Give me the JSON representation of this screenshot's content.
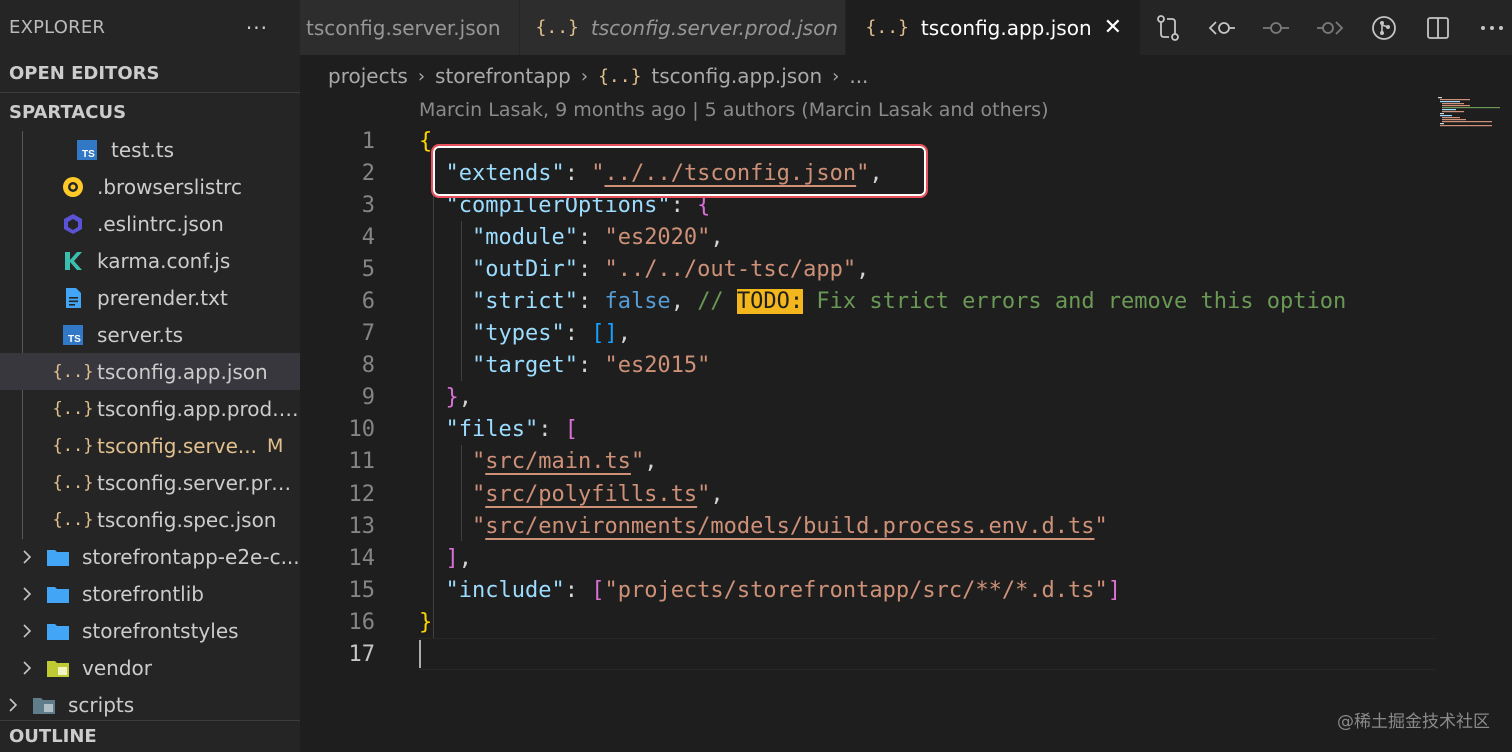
{
  "sidebar": {
    "title": "EXPLORER",
    "more": "···",
    "open_editors": "OPEN EDITORS",
    "project": "SPARTACUS",
    "items": [
      {
        "label": "test.ts",
        "icon": "typescript-icon",
        "mod": ""
      },
      {
        "label": ".browserslistrc",
        "icon": "browserslist-icon",
        "mod": ""
      },
      {
        "label": ".eslintrc.json",
        "icon": "eslint-icon",
        "mod": ""
      },
      {
        "label": "karma.conf.js",
        "icon": "karma-icon",
        "mod": ""
      },
      {
        "label": "prerender.txt",
        "icon": "text-file-icon",
        "mod": ""
      },
      {
        "label": "server.ts",
        "icon": "typescript-icon",
        "mod": ""
      },
      {
        "label": "tsconfig.app.json",
        "icon": "json-icon",
        "mod": ""
      },
      {
        "label": "tsconfig.app.prod.j...",
        "icon": "json-icon",
        "mod": ""
      },
      {
        "label": "tsconfig.serve...",
        "icon": "json-icon",
        "mod": "M"
      },
      {
        "label": "tsconfig.server.pro...",
        "icon": "json-icon",
        "mod": ""
      },
      {
        "label": "tsconfig.spec.json",
        "icon": "json-icon",
        "mod": ""
      }
    ],
    "folders": [
      {
        "label": "storefrontapp-e2e-c...",
        "icon": "folder-icon"
      },
      {
        "label": "storefrontlib",
        "icon": "folder-icon"
      },
      {
        "label": "storefrontstyles",
        "icon": "folder-icon"
      },
      {
        "label": "vendor",
        "icon": "vendor-folder-icon"
      },
      {
        "label": "scripts",
        "icon": "scripts-folder-icon"
      }
    ],
    "outline": "OUTLINE"
  },
  "tabs": [
    {
      "label": "tsconfig.server.json",
      "icon": "",
      "italic": false,
      "active": false
    },
    {
      "label": "tsconfig.server.prod.json",
      "icon": "{..}",
      "italic": true,
      "active": false
    },
    {
      "label": "tsconfig.app.json",
      "icon": "{..}",
      "italic": false,
      "active": true,
      "close": "✕"
    }
  ],
  "editor_actions": [
    "source-control-compare-icon",
    "go-back-change-icon",
    "commit-icon",
    "go-forward-change-icon",
    "git-graph-icon",
    "split-editor-icon",
    "more-actions-icon"
  ],
  "breadcrumb": {
    "parts": [
      "projects",
      "storefrontapp",
      "tsconfig.app.json",
      "..."
    ],
    "file_icon": "{..}",
    "sep": "›"
  },
  "blame": "Marcin Lasak, 9 months ago | 5 authors (Marcin Lasak and others)",
  "code": {
    "line_numbers": [
      "1",
      "2",
      "3",
      "4",
      "5",
      "6",
      "7",
      "8",
      "9",
      "10",
      "11",
      "12",
      "13",
      "14",
      "15",
      "16",
      "17"
    ],
    "l2_key": "\"extends\"",
    "l2_val": "\"../../tsconfig.json\"",
    "l3_key": "\"compilerOptions\"",
    "l4_key": "\"module\"",
    "l4_val": "\"es2020\"",
    "l5_key": "\"outDir\"",
    "l5_val": "\"../../out-tsc/app\"",
    "l6_key": "\"strict\"",
    "l6_val": "false",
    "l6_comment_start": "// ",
    "l6_todo": "TODO:",
    "l6_comment_rest": " Fix strict errors and remove this option",
    "l7_key": "\"types\"",
    "l8_key": "\"target\"",
    "l8_val": "\"es2015\"",
    "l10_key": "\"files\"",
    "l11_val": "src/main.ts",
    "l12_val": "src/polyfills.ts",
    "l13_val": "src/environments/models/build.process.env.d.ts",
    "l15_key": "\"include\"",
    "l15_val": "\"projects/storefrontapp/src/**/*.d.ts\""
  },
  "watermark": "@稀土掘金技术社区"
}
